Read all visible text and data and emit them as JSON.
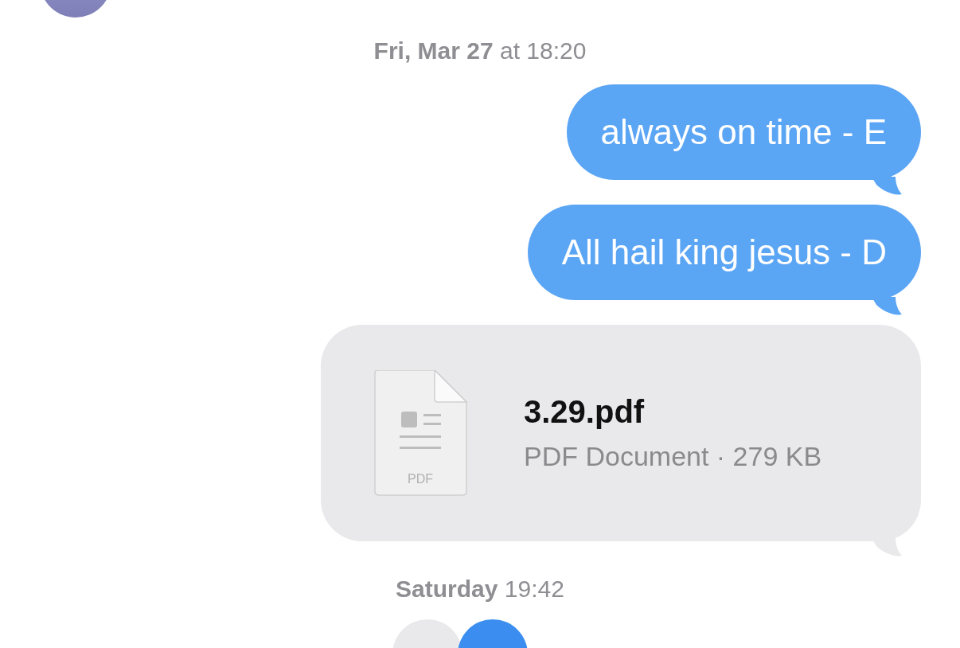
{
  "messages": [
    {
      "kind": "timestamp",
      "text": "**Fri, Mar 27** at 18:20"
    },
    {
      "kind": "outgoing",
      "text": "always on time - E"
    },
    {
      "kind": "outgoing",
      "text": "All hail king jesus - D"
    },
    {
      "kind": "file",
      "name": "3.29.pdf",
      "icon_label": "PDF",
      "details": "PDF Document · 279 KB"
    },
    {
      "kind": "timestamp",
      "text": "**Saturday** 19:42"
    }
  ]
}
